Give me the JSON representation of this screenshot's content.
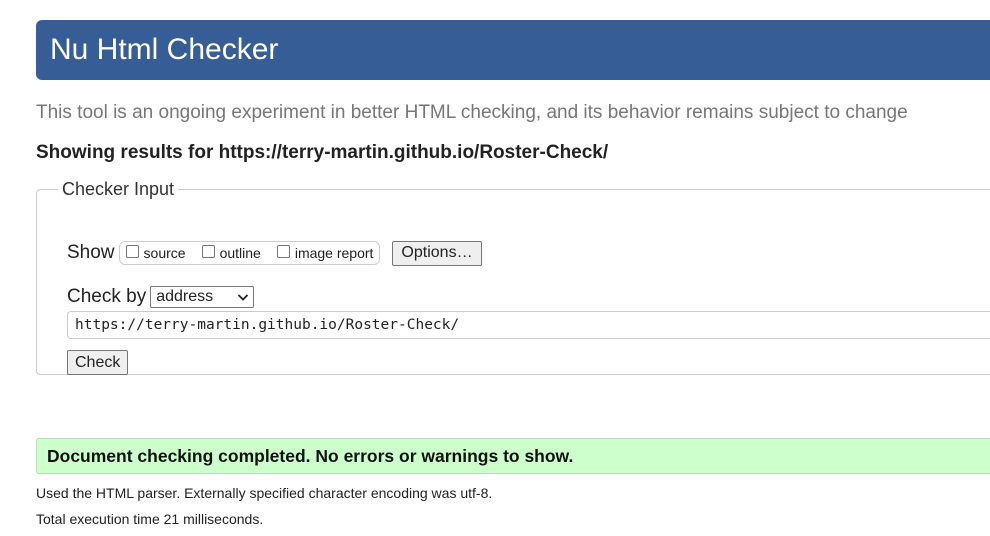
{
  "header": {
    "title": "Nu Html Checker",
    "background_color": "#365d95"
  },
  "tagline": "This tool is an ongoing experiment in better HTML checking, and its behavior remains subject to change",
  "results_for": "Showing results for https://terry-martin.github.io/Roster-Check/",
  "checker_input": {
    "legend": "Checker Input",
    "show_label": "Show",
    "show_options": [
      {
        "label": "source",
        "checked": false
      },
      {
        "label": "outline",
        "checked": false
      },
      {
        "label": "image report",
        "checked": false
      }
    ],
    "options_button": "Options…",
    "check_by_label": "Check by",
    "check_by_selected": "address",
    "url_value": "https://terry-martin.github.io/Roster-Check/",
    "check_button": "Check"
  },
  "result": {
    "message": "Document checking completed. No errors or warnings to show.",
    "color": "#ccffcc"
  },
  "details": {
    "parser": "Used the HTML parser. Externally specified character encoding was utf-8.",
    "execution_time": "Total execution time 21 milliseconds."
  }
}
